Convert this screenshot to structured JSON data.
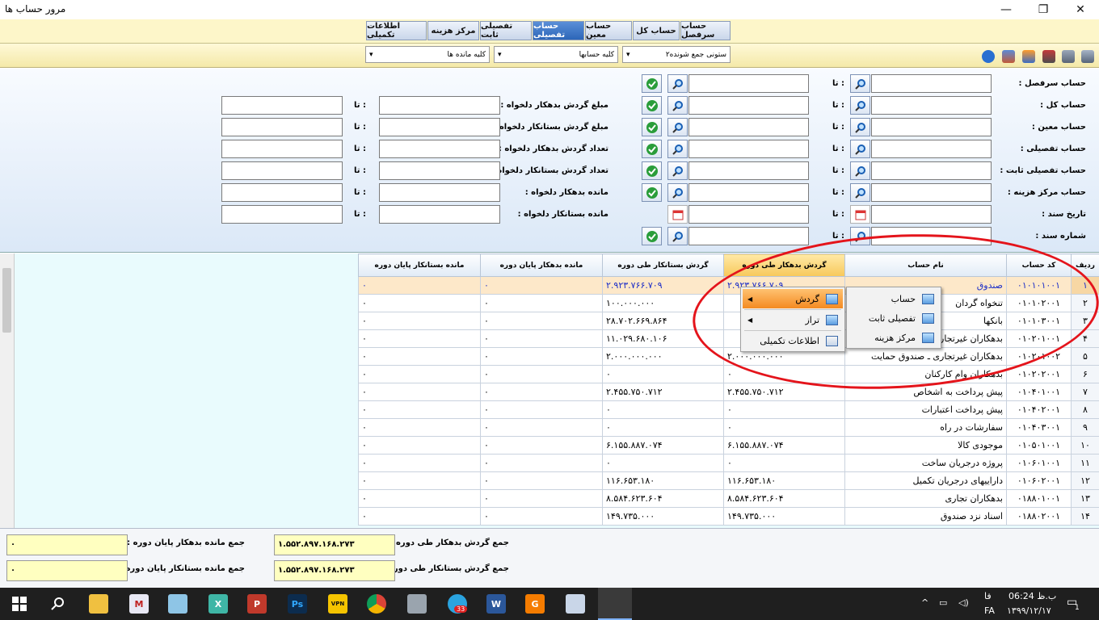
{
  "window": {
    "title": "مرور حساب ها",
    "minimize": "—",
    "maximize": "❐",
    "close": "✕"
  },
  "tabs": [
    {
      "label": "حساب سرفصل"
    },
    {
      "label": "حساب کل"
    },
    {
      "label": "حساب معین"
    },
    {
      "label": "حساب تفصیلی"
    },
    {
      "label": "تفصیلی ثابت"
    },
    {
      "label": "مرکز هزینه"
    },
    {
      "label": "اطلاعات تکمیلی"
    }
  ],
  "toolbar": {
    "combo_columns": "۲ستونی جمع شونده",
    "combo_accounts": "کلیه حسابها",
    "combo_balances": "کلیه مانده ها"
  },
  "filters": {
    "to_label": "تا :",
    "left_labels": [
      "حساب سرفصل :",
      "حساب کل :",
      "حساب معین :",
      "حساب تفصیلی :",
      "حساب تفصیلی ثابت :",
      "حساب مرکز هزینه :",
      "تاریخ سند :",
      "شماره سند :"
    ],
    "right_labels": [
      "مبلغ گردش بدهکار دلخواه :",
      "مبلغ گردش بستانکار دلخواه :",
      "تعداد گردش بدهکار دلخواه :",
      "تعداد گردش بستانکار دلخواه :",
      "مانده بدهکار دلخواه :",
      "مانده بستانکار دلخواه :"
    ]
  },
  "grid": {
    "headers": {
      "row": "ردیف",
      "code": "کد حساب",
      "name": "نام حساب",
      "debit": "گردش بدهکار طی دوره",
      "credit": "گردش بستانکار طی دوره",
      "end_debit": "مانده بدهکار پایان دوره",
      "end_credit": "مانده بستانکار پایان دوره"
    },
    "rows": [
      {
        "n": "۱",
        "code": "۰۱۰۱۰۱۰۰۱",
        "name": "صندوق",
        "debit": "۲.۹۲۳.۷۶۶.۷۰۹",
        "credit": "۲.۹۲۳.۷۶۶.۷۰۹",
        "ed": "۰",
        "ec": "۰"
      },
      {
        "n": "۲",
        "code": "۰۱۰۱۰۲۰۰۱",
        "name": "تنخواه گردان",
        "debit": "",
        "credit": "۱۰۰.۰۰۰.۰۰۰",
        "ed": "۰",
        "ec": "۰"
      },
      {
        "n": "۳",
        "code": "۰۱۰۱۰۳۰۰۱",
        "name": "بانکها",
        "debit": "",
        "credit": "۲۸.۷۰۲.۶۶۹.۸۶۴",
        "ed": "۰",
        "ec": "۰"
      },
      {
        "n": "۴",
        "code": "۰۱۰۲۰۱۰۰۱",
        "name": "بدهکاران غیرتجاری",
        "debit": "",
        "credit": "۱۱.۰۲۹.۶۸۰.۱۰۶",
        "ed": "۰",
        "ec": "۰"
      },
      {
        "n": "۵",
        "code": "۰۱۰۲۰۱۰۰۲",
        "name": "بدهکاران غیرتجاری ـ صندوق حمایت",
        "debit": "۲.۰۰۰.۰۰۰.۰۰۰",
        "credit": "۲.۰۰۰.۰۰۰.۰۰۰",
        "ed": "۰",
        "ec": "۰"
      },
      {
        "n": "۶",
        "code": "۰۱۰۲۰۲۰۰۱",
        "name": "بدهکاران وام کارکنان",
        "debit": "۰",
        "credit": "۰",
        "ed": "۰",
        "ec": "۰"
      },
      {
        "n": "۷",
        "code": "۰۱۰۴۰۱۰۰۱",
        "name": "پیش پرداخت به اشخاص",
        "debit": "۲.۴۵۵.۷۵۰.۷۱۲",
        "credit": "۲.۴۵۵.۷۵۰.۷۱۲",
        "ed": "۰",
        "ec": "۰"
      },
      {
        "n": "۸",
        "code": "۰۱۰۴۰۲۰۰۱",
        "name": "پیش پرداخت اعتبارات",
        "debit": "۰",
        "credit": "۰",
        "ed": "۰",
        "ec": "۰"
      },
      {
        "n": "۹",
        "code": "۰۱۰۴۰۳۰۰۱",
        "name": "سفارشات در راه",
        "debit": "۰",
        "credit": "۰",
        "ed": "۰",
        "ec": "۰"
      },
      {
        "n": "۱۰",
        "code": "۰۱۰۵۰۱۰۰۱",
        "name": "موجودی کالا",
        "debit": "۶.۱۵۵.۸۸۷.۰۷۴",
        "credit": "۶.۱۵۵.۸۸۷.۰۷۴",
        "ed": "۰",
        "ec": "۰"
      },
      {
        "n": "۱۱",
        "code": "۰۱۰۶۰۱۰۰۱",
        "name": "پروژه درجریان ساخت",
        "debit": "۰",
        "credit": "۰",
        "ed": "۰",
        "ec": "۰"
      },
      {
        "n": "۱۲",
        "code": "۰۱۰۶۰۲۰۰۱",
        "name": "داراییهای درجریان تکمیل",
        "debit": "۱۱۶.۶۵۳.۱۸۰",
        "credit": "۱۱۶.۶۵۳.۱۸۰",
        "ed": "۰",
        "ec": "۰"
      },
      {
        "n": "۱۳",
        "code": "۰۱۸۸۰۱۰۰۱",
        "name": "بدهکاران تجاری",
        "debit": "۸.۵۸۴.۶۲۳.۶۰۴",
        "credit": "۸.۵۸۴.۶۲۳.۶۰۴",
        "ed": "۰",
        "ec": "۰"
      },
      {
        "n": "۱۴",
        "code": "۰۱۸۸۰۲۰۰۱",
        "name": "اسناد نزد صندوق",
        "debit": "۱۴۹.۷۳۵.۰۰۰",
        "credit": "۱۴۹.۷۳۵.۰۰۰",
        "ed": "۰",
        "ec": "۰"
      }
    ]
  },
  "context_menu_left": {
    "items": [
      {
        "label": "گردش"
      },
      {
        "label": "تراز"
      },
      {
        "label": "اطلاعات تکمیلی"
      }
    ]
  },
  "context_menu_right": {
    "items": [
      {
        "label": "حساب"
      },
      {
        "label": "تفصیلی ثابت"
      },
      {
        "label": "مرکز هزینه"
      }
    ]
  },
  "totals": {
    "sum_debit_label": "جمع گردش بدهکار طی دوره :",
    "sum_debit": "۱.۵۵۲.۸۹۷.۱۶۸.۲۷۳",
    "sum_credit_label": "جمع گردش بستانکار طی دوره :",
    "sum_credit": "۱.۵۵۲.۸۹۷.۱۶۸.۲۷۳",
    "end_debit_label": "جمع مانده بدهکار پایان دوره :",
    "end_debit": "۰",
    "end_credit_label": "جمع مانده بستانکار پایان دوره :",
    "end_credit": "۰"
  },
  "taskbar": {
    "telegram_badge": "33",
    "lang": "فا",
    "lang2": "FA",
    "time": "ب.ظ 06:24",
    "date": "۱۳۹۹/۱۲/۱۷",
    "notif_count": "1"
  }
}
